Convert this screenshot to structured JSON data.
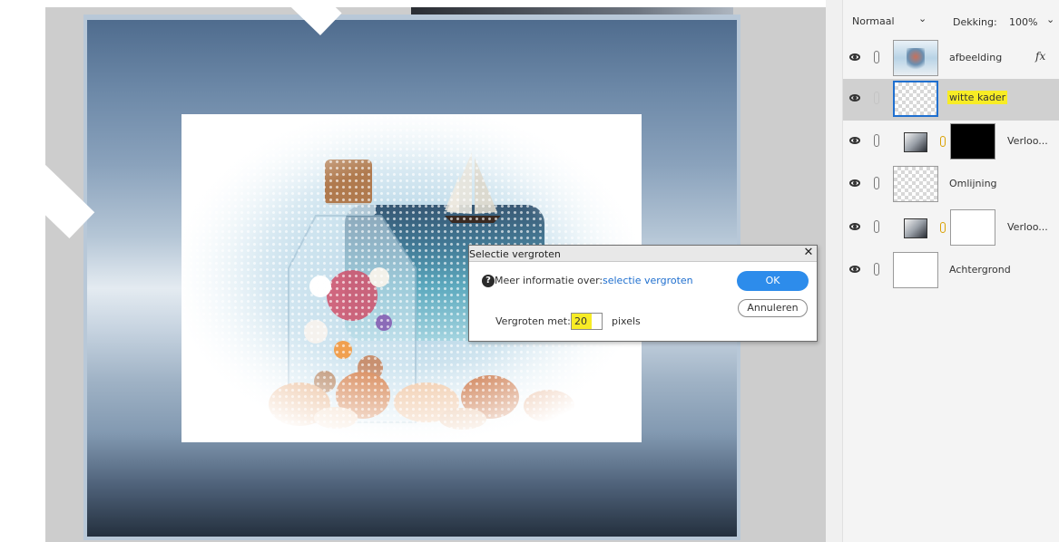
{
  "dialog": {
    "title": "Selectie vergroten",
    "close_icon": "close-icon",
    "help_label": "Meer informatie over:",
    "help_link": "selectie vergroten",
    "ok_label": "OK",
    "cancel_label": "Annuleren",
    "expand_label": "Vergroten met:",
    "expand_value": "20",
    "expand_unit": "pixels"
  },
  "layers_panel": {
    "blend_mode": "Normaal",
    "opacity_label": "Dekking:",
    "opacity_value": "100%",
    "layers": [
      {
        "name": "afbeelding",
        "fx": "fx",
        "selected": false
      },
      {
        "name": "witte kader",
        "selected": true
      },
      {
        "name": "Verloo...",
        "mask": "black"
      },
      {
        "name": "Omlijning"
      },
      {
        "name": "Verloo...",
        "mask": "white"
      },
      {
        "name": "Achtergrond"
      }
    ]
  },
  "colors": {
    "accent": "#2d8ceb",
    "highlight": "#f7ec25",
    "link": "#1f6fcf"
  }
}
